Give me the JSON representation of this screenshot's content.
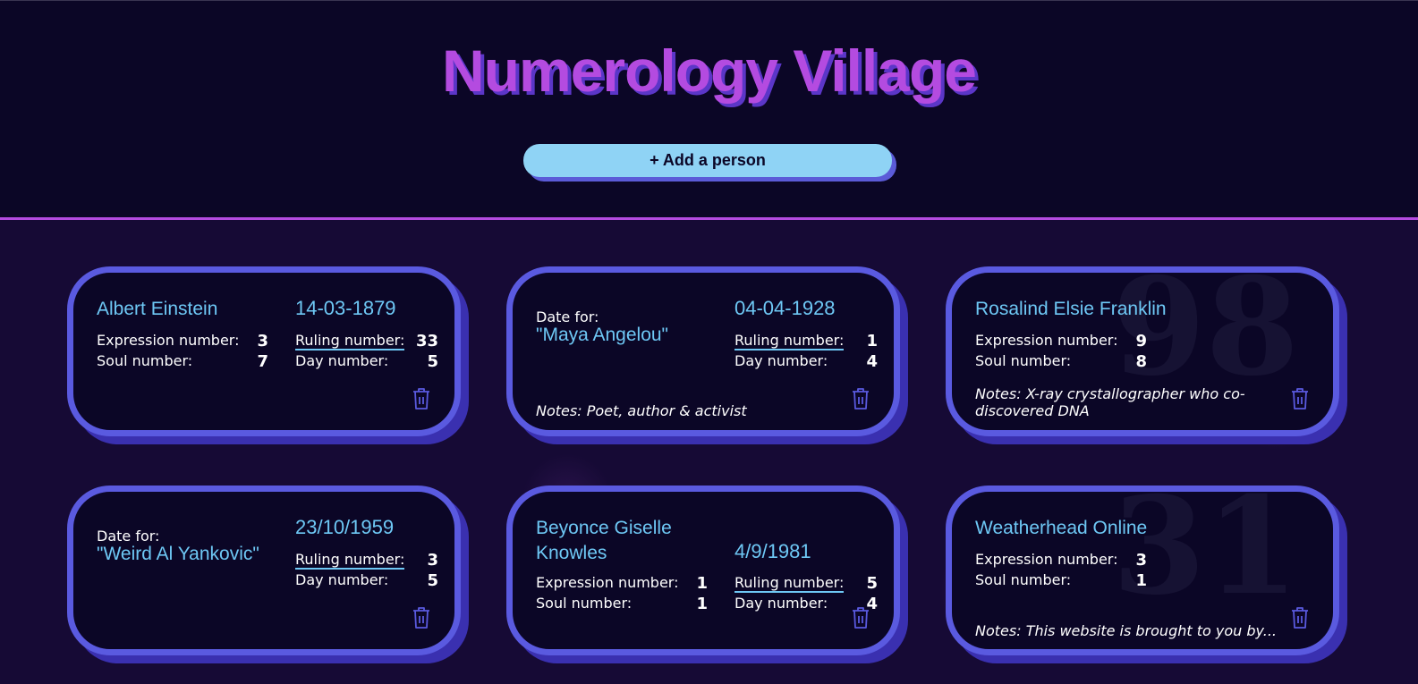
{
  "app": {
    "title": "Numerology Village",
    "add_button": "+ Add a person"
  },
  "labels": {
    "expression": "Expression number:",
    "soul": "Soul number:",
    "ruling": "Ruling number:",
    "day": "Day number:",
    "date_for": "Date for:"
  },
  "cards": [
    {
      "name": "Albert Einstein",
      "date": "14-03-1879",
      "expression": "3",
      "soul": "7",
      "ruling": "33",
      "day": "5"
    },
    {
      "name": "\"Maya Angelou\"",
      "date": "04-04-1928",
      "ruling": "1",
      "day": "4",
      "notes": "Notes: Poet, author & activist"
    },
    {
      "name": "Rosalind Elsie Franklin",
      "expression": "9",
      "soul": "8",
      "background_number": "98",
      "notes": "Notes: X-ray crystallographer who co-discovered DNA"
    },
    {
      "name": "\"Weird Al Yankovic\"",
      "date": "23/10/1959",
      "ruling": "3",
      "day": "5"
    },
    {
      "name": "Beyonce Giselle Knowles",
      "date": "4/9/1981",
      "expression": "1",
      "soul": "1",
      "ruling": "5",
      "day": "4"
    },
    {
      "name": "Weatherhead Online",
      "expression": "3",
      "soul": "1",
      "background_number": "31",
      "notes": "Notes: This website is brought to you by..."
    }
  ],
  "colors": {
    "background": "#0b0626",
    "accent_purple": "#b44be0",
    "card_border": "#5a5ae0",
    "name_blue": "#6ec8f5",
    "button_bg": "#8fd3f5"
  },
  "icons": {
    "delete": "trash-icon"
  }
}
